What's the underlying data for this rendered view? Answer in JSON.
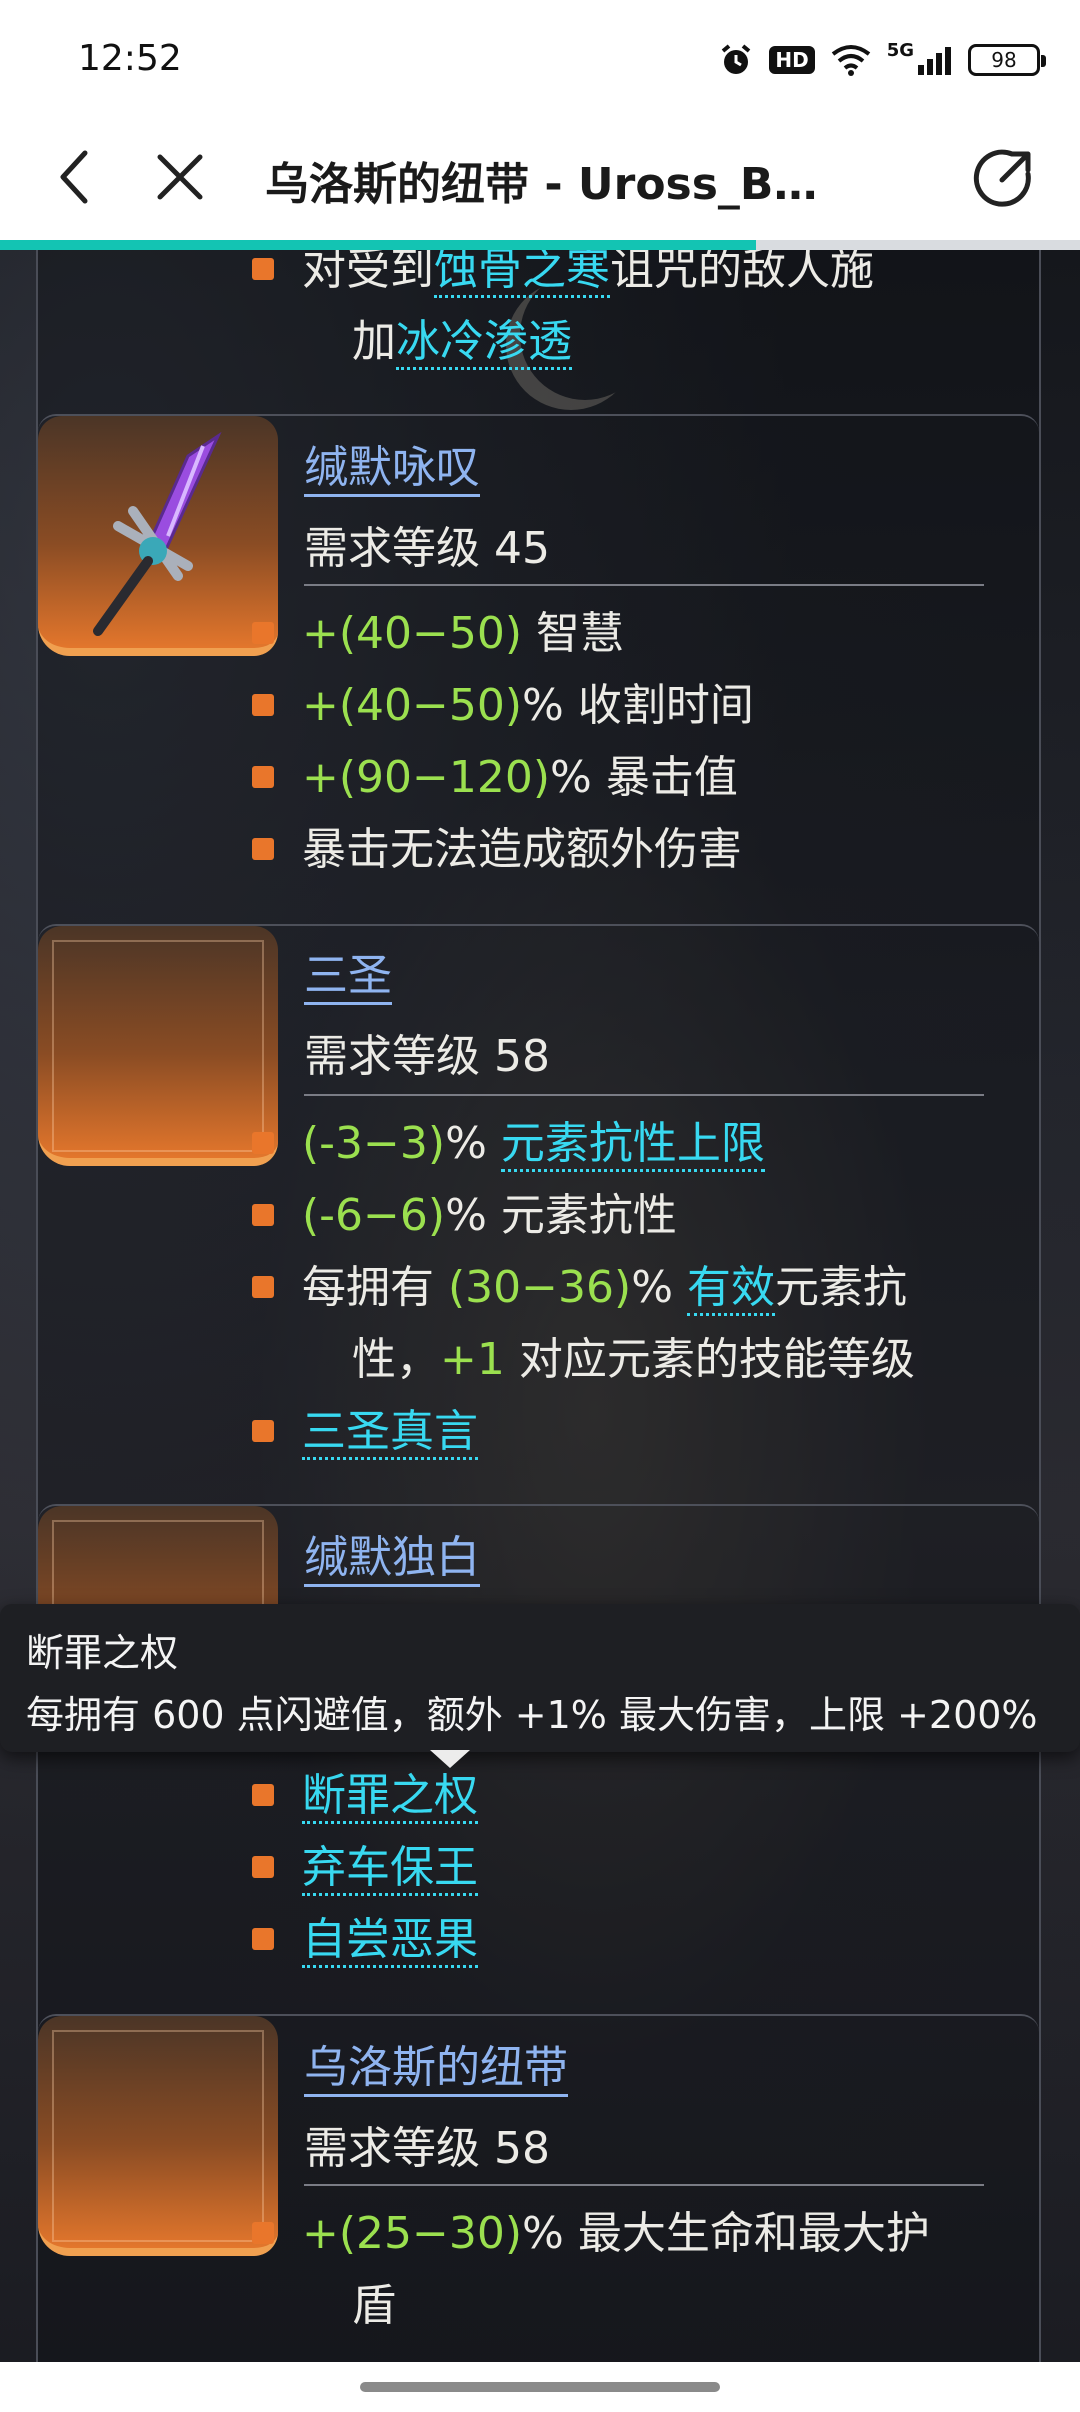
{
  "status": {
    "time": "12:52",
    "hd": "HD",
    "network": "5G",
    "battery": "98"
  },
  "nav": {
    "title": "乌洛斯的纽带 - Uross_B…",
    "icons": [
      "back-arrow-icon",
      "close-icon",
      "share-icon"
    ]
  },
  "progress": 0.7,
  "top_section": {
    "line1_prefix": "对受到",
    "line1_link": "蚀骨之寒",
    "line1_suffix": "诅咒的敌人施",
    "line2_prefix": "加",
    "line2_link": "冰冷渗透"
  },
  "cards": [
    {
      "name": "缄默咏叹",
      "req": "需求等级 45",
      "thumb": "purple-sword-icon",
      "mods": [
        {
          "green": "+(40−50)",
          "text": " 智慧"
        },
        {
          "green": "+(40−50)",
          "text": "% 收割时间"
        },
        {
          "green": "+(90−120)",
          "text": "% 暴击值"
        },
        {
          "green": "",
          "text": "暴击无法造成额外伤害"
        }
      ]
    },
    {
      "name": "三圣",
      "req": "需求等级 58",
      "mods": [
        {
          "green": "(-3−3)",
          "text": "% ",
          "link": "元素抗性上限"
        },
        {
          "green": "(-6−6)",
          "text": "% 元素抗性"
        },
        {
          "prefix": "每拥有 ",
          "green": "(30−36)",
          "text": "% ",
          "link": "有效",
          "suffix": "元素抗"
        },
        {
          "cont_prefix": "性，",
          "cont_green": "+1",
          "cont_text": " 对应元素的技能等级"
        },
        {
          "link": "三圣真言"
        }
      ]
    },
    {
      "name": "缄默独白",
      "mods": [
        {
          "link": "断罪之权"
        },
        {
          "link": "弃车保王"
        },
        {
          "link": "自尝恶果"
        }
      ]
    },
    {
      "name": "乌洛斯的纽带",
      "req": "需求等级 58",
      "mods": [
        {
          "green": "+(25−30)",
          "text": "% 最大生命和最大护"
        },
        {
          "cont_text": "盾"
        }
      ]
    }
  ],
  "tooltip": {
    "title": "断罪之权",
    "body": "每拥有 600 点闪避值，额外 +1% 最大伤害，上限 +200%"
  },
  "colors": {
    "accent": "#13c4b3",
    "bullet": "#e9762b",
    "green": "#9be04f",
    "link": "#38d9f1",
    "name": "#8fb4f0"
  }
}
